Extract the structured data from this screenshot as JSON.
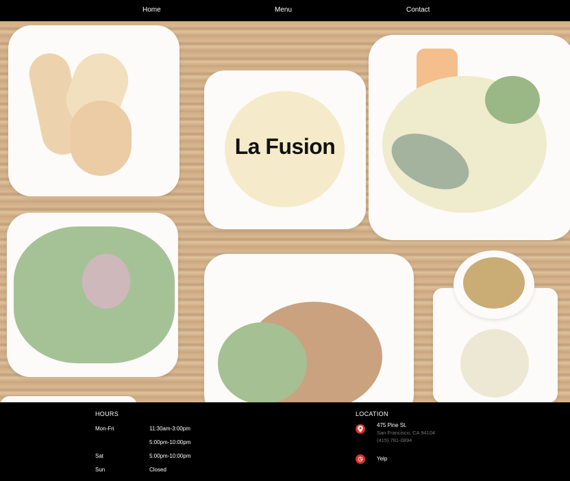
{
  "nav": {
    "home": "Home",
    "menu": "Menu",
    "contact": "Contact"
  },
  "hero": {
    "title": "La Fusion"
  },
  "hours": {
    "heading": "HOURS",
    "rows": [
      {
        "day": "Mon-Fri",
        "time": "11:30am-3:00pm"
      },
      {
        "day": "",
        "time": "5:00pm-10:00pm"
      },
      {
        "day": "Sat",
        "time": "5:00pm-10:00pm"
      },
      {
        "day": "Sun",
        "time": "Closed"
      }
    ]
  },
  "location": {
    "heading": "LOCATION",
    "street": "475 Pine St.",
    "city": "San Francisco, CA 94104",
    "phone": "(415) 781-0894",
    "yelp": "Yelp"
  },
  "colors": {
    "icon_red": "#d8322b",
    "nav_bg": "#000000"
  },
  "icons": {
    "location": "map-pin-icon",
    "yelp": "yelp-icon"
  }
}
